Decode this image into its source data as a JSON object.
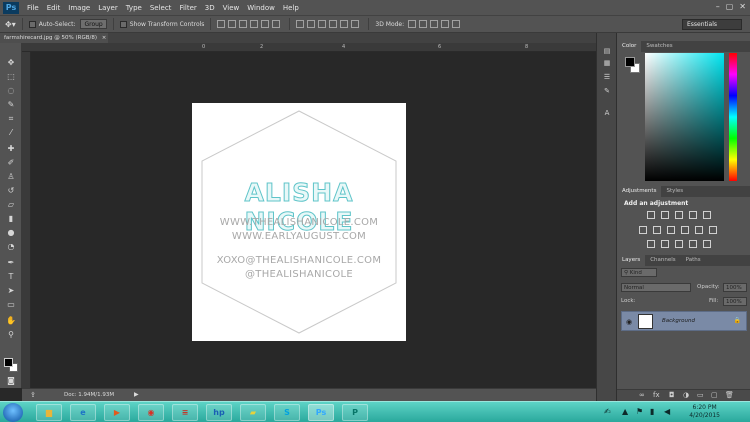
{
  "app": {
    "logo": "Ps"
  },
  "menu": [
    "File",
    "Edit",
    "Image",
    "Layer",
    "Type",
    "Select",
    "Filter",
    "3D",
    "View",
    "Window",
    "Help"
  ],
  "window_controls": [
    "–",
    "▢",
    "✕"
  ],
  "options": {
    "auto_select_label": "Auto-Select:",
    "auto_select_value": "Group",
    "transform_label": "Show Transform Controls",
    "mode_label": "3D Mode:",
    "workspace": "Essentials"
  },
  "document": {
    "tab_title": "farmshirecard.jpg @ 50% (RGB/8)",
    "status": "Doc: 1.94M/1.93M",
    "card": {
      "name": "ALISHA NICOLE",
      "line1": "WWW.THEALISHANICOLE.COM",
      "line2": "WWW.EARLYAUGUST.COM",
      "line3": "XOXO@THEALISHANICOLE.COM",
      "line4": "@THEALISHANICOLE"
    },
    "ruler_ticks": [
      "0",
      "2",
      "4",
      "6",
      "8"
    ]
  },
  "color_panel": {
    "tabs": [
      "Color",
      "Swatches"
    ]
  },
  "adjustments_panel": {
    "tabs": [
      "Adjustments",
      "Styles"
    ],
    "title": "Add an adjustment"
  },
  "layers_panel": {
    "tabs": [
      "Layers",
      "Channels",
      "Paths"
    ],
    "kind": "Kind",
    "blend_mode": "Normal",
    "opacity_label": "Opacity:",
    "opacity_value": "100%",
    "lock_label": "Lock:",
    "fill_label": "Fill:",
    "fill_value": "100%",
    "layer_name": "Background"
  },
  "taskbar": {
    "time": "6:20 PM",
    "date": "4/20/2015",
    "apps": [
      "folder",
      "internet-explorer",
      "media-player",
      "chrome",
      "stack",
      "hp",
      "sticky-notes",
      "skype",
      "photoshop",
      "publisher"
    ]
  }
}
